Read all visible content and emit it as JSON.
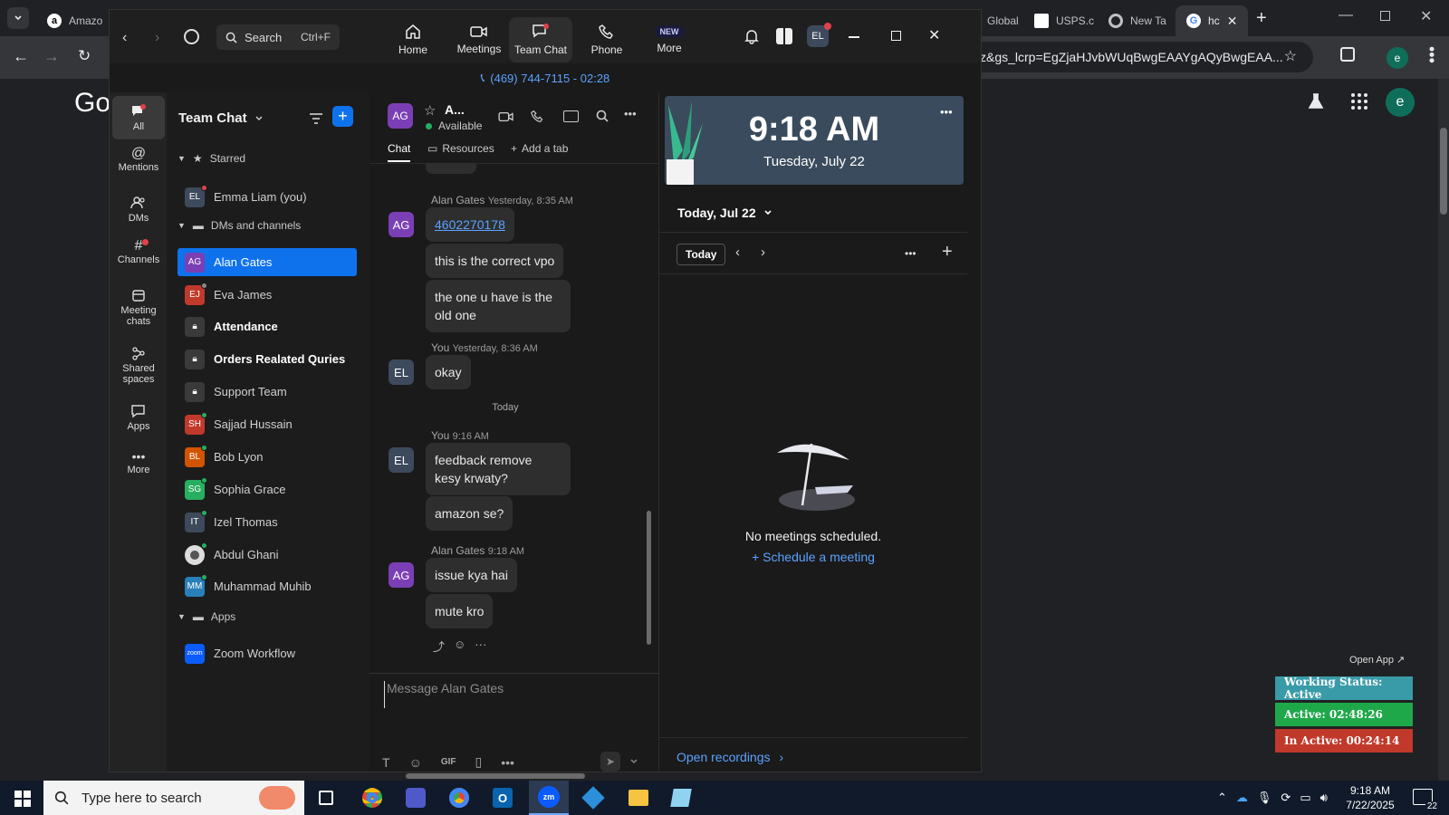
{
  "browser": {
    "tabs": [
      {
        "label": "Amazo",
        "color": "#232f3e"
      },
      {
        "label": "Global",
        "color": "#3b82f6"
      },
      {
        "label": "USPS.c",
        "color": "#3356a5"
      },
      {
        "label": "New Ta",
        "color": "#5f6368"
      },
      {
        "label": "hc",
        "color": "#4285f4"
      }
    ],
    "address_text": "z&gs_lcrp=EgZjaHJvbWUqBwgEAAYgAQyBwgEAA...",
    "profile_letter": "e",
    "google_partial": "Go"
  },
  "zoom": {
    "search_label": "Search",
    "search_shortcut": "Ctrl+F",
    "nav": [
      {
        "label": "Home",
        "icon": "home-icon"
      },
      {
        "label": "Meetings",
        "icon": "video-icon"
      },
      {
        "label": "Team Chat",
        "icon": "chat-icon"
      },
      {
        "label": "Phone",
        "icon": "phone-icon"
      },
      {
        "label": "More",
        "icon": "more-icon",
        "badge": "NEW"
      }
    ],
    "profile_initials": "EL",
    "call_bar": "(469) 744-7115 - 02:28",
    "rail": [
      {
        "label": "All",
        "icon": "chat-bubble-icon"
      },
      {
        "label": "Mentions",
        "icon": "at-icon"
      },
      {
        "label": "DMs",
        "icon": "people-icon"
      },
      {
        "label": "Channels",
        "icon": "hash-icon"
      },
      {
        "label": "Meeting chats",
        "icon": "calendar-icon"
      },
      {
        "label": "Shared spaces",
        "icon": "share-icon"
      },
      {
        "label": "Apps",
        "icon": "apps-icon"
      },
      {
        "label": "More",
        "icon": "ellipsis-icon"
      }
    ],
    "list": {
      "title": "Team Chat",
      "starred_label": "Starred",
      "starred": [
        {
          "name": "Emma Liam (you)",
          "initials": "EL",
          "color": "#3d4a5c"
        }
      ],
      "dms_label": "DMs and channels",
      "dms": [
        {
          "name": "Alan Gates",
          "initials": "AG",
          "color": "#7b3fb5",
          "bold": false
        },
        {
          "name": "Eva James",
          "initials": "EJ",
          "color": "#c0392b",
          "bold": false
        },
        {
          "name": "Attendance",
          "initials": "",
          "color": "#3a3a3a",
          "bold": true
        },
        {
          "name": "Orders Realated Quries",
          "initials": "",
          "color": "#3a3a3a",
          "bold": true
        },
        {
          "name": "Support Team",
          "initials": "",
          "color": "#3a3a3a",
          "bold": false
        },
        {
          "name": "Sajjad Hussain",
          "initials": "SH",
          "color": "#c0392b",
          "bold": false
        },
        {
          "name": "Bob Lyon",
          "initials": "BL",
          "color": "#d35400",
          "bold": false
        },
        {
          "name": "Sophia Grace",
          "initials": "SG",
          "color": "#27ae60",
          "bold": false
        },
        {
          "name": "Izel Thomas",
          "initials": "IT",
          "color": "#3d4a5c",
          "bold": false
        },
        {
          "name": "Abdul Ghani",
          "initials": "",
          "color": "#dddddd",
          "bold": false
        },
        {
          "name": "Muhammad Muhib",
          "initials": "MM",
          "color": "#2980b9",
          "bold": false
        }
      ],
      "apps_label": "Apps",
      "apps": [
        {
          "name": "Zoom Workflow",
          "initials": "zoom",
          "color": "#0b5cff"
        }
      ]
    },
    "chat": {
      "contact_initials": "AG",
      "contact_name": "A...",
      "status": "Available",
      "tabs": [
        "Chat",
        "Resources",
        "Add a tab"
      ],
      "messages": [
        {
          "sender": "Alan Gates",
          "time": "Yesterday, 8:35 AM",
          "initials": "AG",
          "bubbles": [
            "4602270178",
            "this is the correct vpo",
            "the one u have is the\nold one"
          ]
        },
        {
          "sender": "You",
          "time": "Yesterday, 8:36 AM",
          "initials": "EL",
          "bubbles": [
            "okay"
          ]
        },
        {
          "sender": "You",
          "time": "9:16 AM",
          "initials": "EL",
          "bubbles": [
            "feedback remove\nkesy krwaty?",
            "amazon se?"
          ]
        },
        {
          "sender": "Alan Gates",
          "time": "9:18 AM",
          "initials": "AG",
          "bubbles": [
            "issue kya hai",
            "mute kro"
          ]
        }
      ],
      "day_divider": "Today",
      "composer_placeholder": "Message Alan Gates",
      "gif_label": "GIF"
    },
    "calendar": {
      "time": "9:18 AM",
      "date": "Tuesday, July 22",
      "today_header": "Today, Jul 22",
      "today_button": "Today",
      "empty_text": "No meetings scheduled.",
      "schedule_link": "Schedule a meeting",
      "recordings_link": "Open recordings"
    }
  },
  "overlay": {
    "open_app": "Open App ↗",
    "working_status": "Working Status: Active",
    "active": "Active: 02:48:26",
    "inactive": "In Active: 00:24:14",
    "colors": {
      "working": "#3a9ba8",
      "active": "#1fa84a",
      "inactive": "#c0392b"
    }
  },
  "taskbar": {
    "search_placeholder": "Type here to search",
    "clock_time": "9:18 AM",
    "clock_date": "7/22/2025",
    "notification_count": "22"
  }
}
